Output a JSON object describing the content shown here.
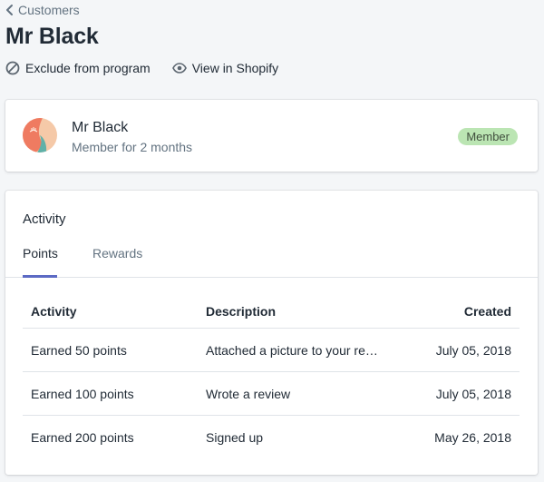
{
  "breadcrumb": {
    "label": "Customers"
  },
  "page": {
    "title": "Mr Black"
  },
  "actions": {
    "exclude_label": "Exclude from program",
    "view_label": "View in Shopify"
  },
  "profile": {
    "name": "Mr Black",
    "subtitle": "Member for 2 months",
    "badge": "Member",
    "badge_color": "#bbe5b3"
  },
  "activity": {
    "heading": "Activity",
    "tabs": [
      {
        "label": "Points",
        "active": true
      },
      {
        "label": "Rewards",
        "active": false
      }
    ],
    "columns": {
      "activity": "Activity",
      "description": "Description",
      "created": "Created"
    },
    "rows": [
      {
        "activity": "Earned 50 points",
        "description": "Attached a picture to your re…",
        "created": "July 05, 2018"
      },
      {
        "activity": "Earned 100 points",
        "description": "Wrote a review",
        "created": "July 05, 2018"
      },
      {
        "activity": "Earned 200 points",
        "description": "Signed up",
        "created": "May 26, 2018"
      }
    ]
  },
  "colors": {
    "accent": "#5c6ac4",
    "text": "#212b36",
    "muted": "#637381",
    "background": "#f4f6f8"
  },
  "icons": {
    "back": "chevron-left-icon",
    "exclude": "circle-slash-icon",
    "view": "eye-icon",
    "avatar": "avatar-illustration"
  }
}
